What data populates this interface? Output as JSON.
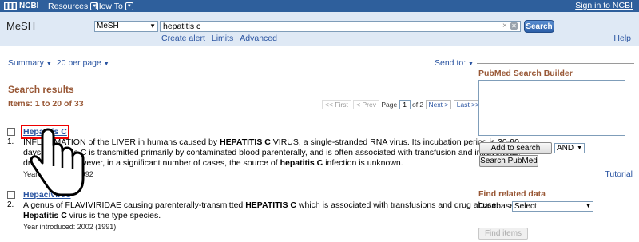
{
  "topbar": {
    "logo_text": "NCBI",
    "resources_label": "Resources",
    "howto_label": "How To",
    "signin_label": "Sign in to NCBI"
  },
  "header": {
    "db_name": "MeSH",
    "db_select_value": "MeSH",
    "search_value": "hepatitis c",
    "search_button": "Search",
    "links": [
      "Create alert",
      "Limits",
      "Advanced"
    ],
    "help_label": "Help"
  },
  "toolbar": {
    "summary_label": "Summary",
    "per_page_label": "20 per page",
    "send_to_label": "Send to:"
  },
  "results": {
    "title": "Search results",
    "count_label": "Items: 1 to 20 of 33",
    "pager": {
      "first": "<< First",
      "prev": "< Prev",
      "page_label": "Page",
      "page_value": "1",
      "of_label": "of 2",
      "next": "Next >",
      "last": "Last >>"
    },
    "items": [
      {
        "num": "1.",
        "title": "Hepatitis C",
        "line1_a": "INFLAMMATION of the LIVER in humans caused by ",
        "line1_b": "HEPATITIS C",
        "line1_c": " VIRUS, a single-stranded RNA virus. Its incubation period is 30-90",
        "line2": "days. Hepatitis C is transmitted primarily by contaminated blood parenterally, and is often associated with transfusion and intravenous",
        "line3_a": "drug abuse. However, in a significant number of cases, the source of ",
        "line3_b": "hepatitis C",
        "line3_c": " infection is unknown.",
        "year": "Year introduced: 1992"
      },
      {
        "num": "2.",
        "title": "Hepacivirus",
        "line1_a": "A genus of FLAVIVIRIDAE causing parenterally-transmitted ",
        "line1_b": "HEPATITIS C",
        "line1_c": " which is associated with transfusions and drug abuse.",
        "line2_a": "Hepatitis C",
        "line2_b": " virus is the type species.",
        "year": "Year introduced: 2002 (1991)"
      }
    ]
  },
  "sidebar": {
    "builder_title": "PubMed Search Builder",
    "add_button": "Add to search builder",
    "bool_value": "AND",
    "search_pubmed": "Search PubMed",
    "tutorial": "Tutorial",
    "related_title": "Find related data",
    "database_label": "Database:",
    "database_value": "Select",
    "find_items": "Find items"
  },
  "colors": {
    "ncbi_bar": "#2e5f9c",
    "link": "#2a54a1",
    "heading": "#985735",
    "highlight_box": "#ee0000"
  }
}
